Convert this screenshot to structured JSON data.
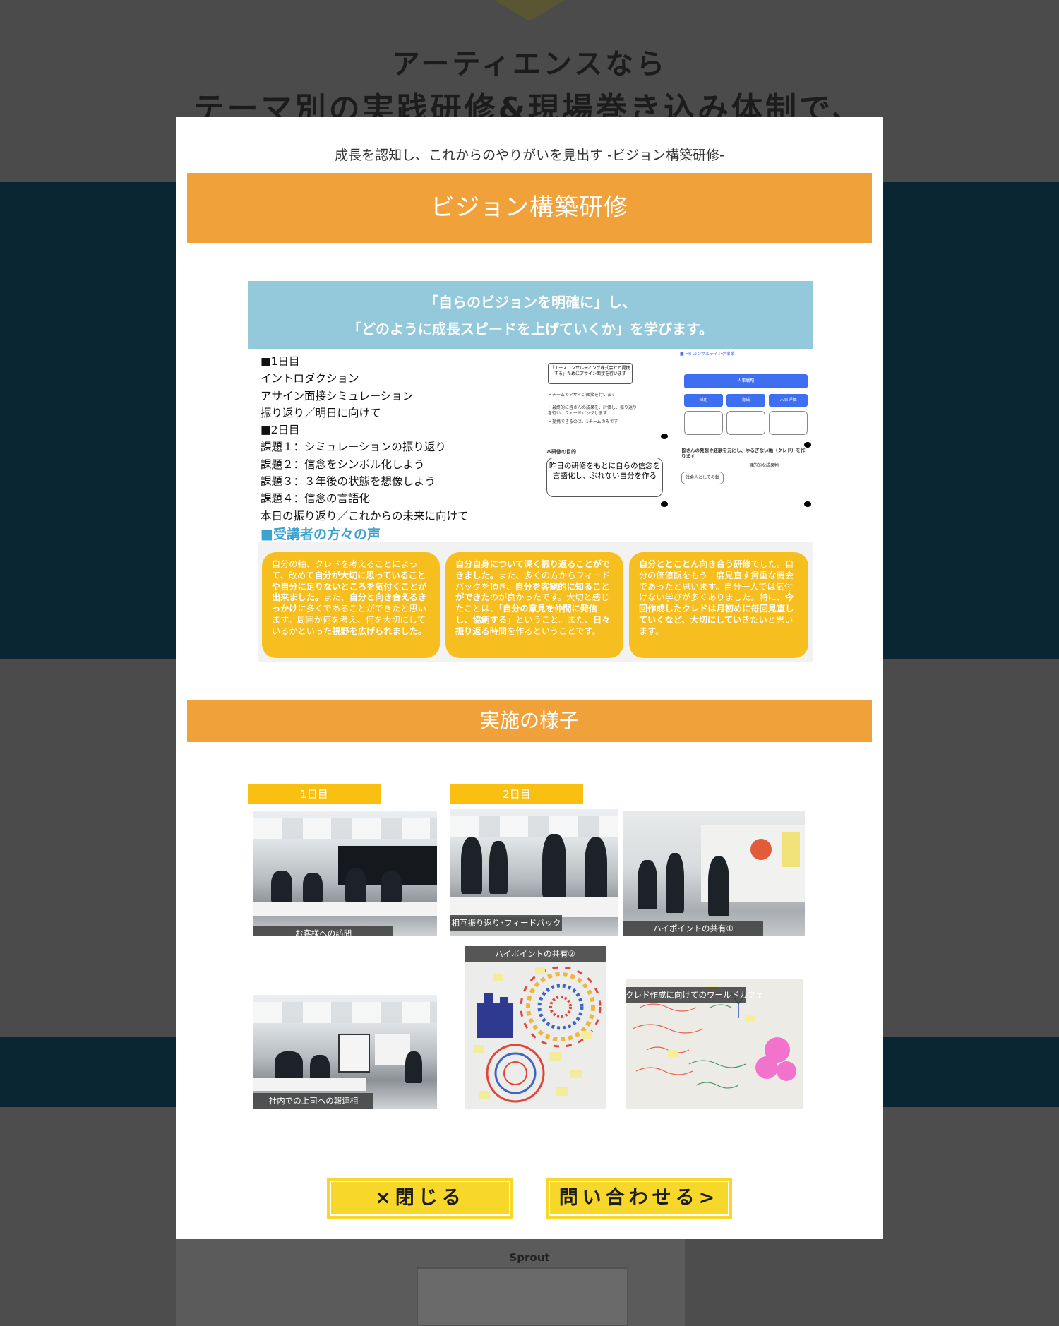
{
  "background": {
    "heading_line1": "アーティエンスなら",
    "heading_line2": "テーマ別の実践研修&現場巻き込み体制で、",
    "card_title": "Sprout"
  },
  "modal": {
    "subtitle": "成長を認知し、これからのやりがいを見出す -ビジョン構築研修-",
    "banner_title": "ビジョン構築研修",
    "section_title": "実施の様子"
  },
  "infographic": {
    "head_line1": "「自らのビジョンを明確に」し、",
    "head_line2": "「どのように成長スピードを上げていくか」を学びます。",
    "schedule": [
      "■1日目",
      "イントロダクション",
      "アサイン面接シミュレーション",
      "振り返り／明日に向けて",
      "■2日目",
      "課題１：シミュレーションの振り返り",
      "課題２：信念をシンボル化しよう",
      "課題３：３年後の状態を想像しよう",
      "課題４：信念の言語化",
      "本日の振り返り／これからの未来に向けて"
    ],
    "voice_heading": "■受講者の方々の声",
    "slide1": {
      "box_text": "「エースコンサルティング株式会社と提携する」ためにアサイン面接を行います",
      "bullet1": "・チームでアサイン面接を行います",
      "bullet2": "・最終的に皆さんの成果を、評価し、振り返りを行い、フィードバックします",
      "bullet3": "・提携できるのは、1チームのみです",
      "goal_label": "本研修の目的",
      "goal_text": "昨日の研修をもとに自らの信念を言語化し、ぶれない自分を作る"
    },
    "slide2": {
      "header": "■ HR コンサルティング事業",
      "main_button": "人事戦略",
      "sub_buttons": [
        "採用",
        "育成",
        "人事評価"
      ],
      "bottom_text": "皆さんの発想や経験を元にし、ゆるぎない軸（クレド）を作ります",
      "credo_label": "社会人としての軸",
      "credo_title": "目的的な成果物"
    }
  },
  "voices": [
    {
      "segments": [
        {
          "t": "自分の軸、クレドを考えることによって、改めて",
          "b": false
        },
        {
          "t": "自分が大切に思っていることや自分に足りないところを気付くことが出来ました。",
          "b": true
        },
        {
          "t": "また、",
          "b": false
        },
        {
          "t": "自分と向き合えるきっかけ",
          "b": true
        },
        {
          "t": "に多くであることができたと思います。周囲が何を考え、何を大切にしているかといった",
          "b": false
        },
        {
          "t": "視野を広げられました。",
          "b": true
        }
      ]
    },
    {
      "segments": [
        {
          "t": "自分自身について深く振り返ることができました。",
          "b": true
        },
        {
          "t": "また、多くの方からフィードバックを頂き、",
          "b": false
        },
        {
          "t": "自分を客観的に知ることができた",
          "b": true
        },
        {
          "t": "のが良かったです。大切と感じたことは、「",
          "b": false
        },
        {
          "t": "自分の意見を仲間に発信し、協創する",
          "b": true
        },
        {
          "t": "」ということ。また、",
          "b": false
        },
        {
          "t": "日々振り返る",
          "b": true
        },
        {
          "t": "時間を作るということです。",
          "b": false
        }
      ]
    },
    {
      "segments": [
        {
          "t": "自分ととことん向き合う研修",
          "b": true
        },
        {
          "t": "でした。自分の価値観をもう一度見直す貴重な機会であったと思います。自分一人では気付けない学びが多くありました。特に、",
          "b": false
        },
        {
          "t": "今回作成したクレドは月初めに毎回見直していくなど、大切にしていきたい",
          "b": true
        },
        {
          "t": "と思います。",
          "b": false
        }
      ]
    }
  ],
  "photos": {
    "day1_label": "1日目",
    "day2_label": "2日目",
    "captions": {
      "visit": "お客様への訪問",
      "report": "社内での上司への報連相",
      "feedback": "相互振り返り･フィードバック",
      "highpoint1": "ハイポイントの共有①",
      "highpoint2": "ハイポイントの共有②",
      "worldcafe": "クレド作成に向けてのワールドカフェ"
    }
  },
  "buttons": {
    "close_label": "×閉じる",
    "contact_label": "問い合わせる>"
  },
  "colors": {
    "banner": "#f0a139",
    "voice_card": "#f7be1f",
    "button": "#f7d82a",
    "info_header": "#94c9dc",
    "dark_band": "#0b2633"
  }
}
